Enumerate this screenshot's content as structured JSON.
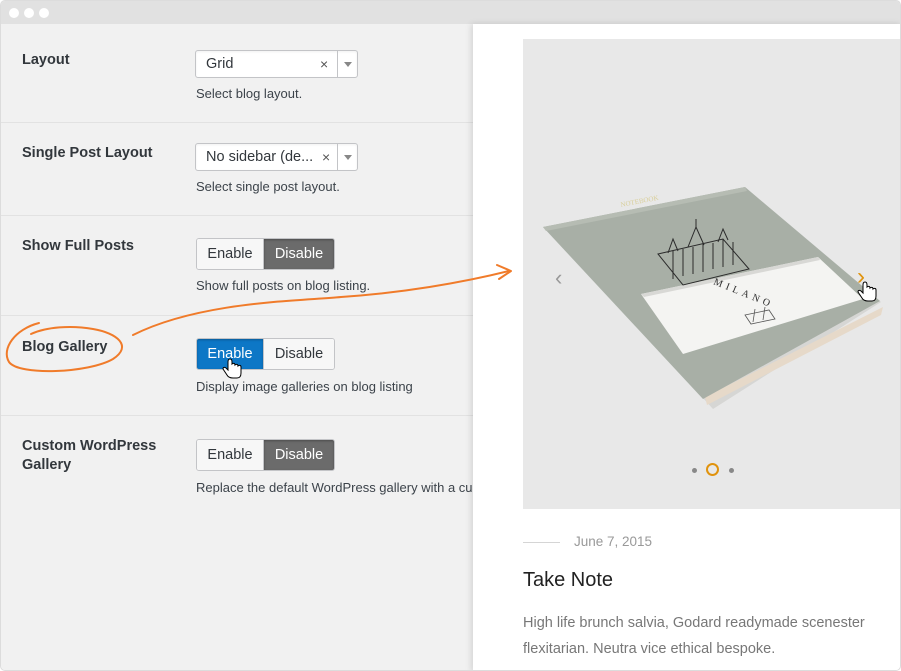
{
  "settings": {
    "layout": {
      "label": "Layout",
      "value": "Grid",
      "clear": "×",
      "description": "Select blog layout."
    },
    "single_post_layout": {
      "label": "Single Post Layout",
      "value": "No sidebar (de...",
      "clear": "×",
      "description": "Select single post layout."
    },
    "show_full_posts": {
      "label": "Show Full Posts",
      "enable": "Enable",
      "disable": "Disable",
      "selected": "Disable",
      "description": "Show full posts on blog listing."
    },
    "blog_gallery": {
      "label": "Blog Gallery",
      "enable": "Enable",
      "disable": "Disable",
      "selected": "Enable",
      "description": "Display image galleries on blog listing"
    },
    "custom_wp_gallery": {
      "label": "Custom WordPress Gallery",
      "enable": "Enable",
      "disable": "Disable",
      "selected": "Disable",
      "description": "Replace the default WordPress gallery with a cu"
    }
  },
  "preview": {
    "notebook_cover_text": "MILANO",
    "notebook_brand": "NOTEBOOK",
    "slider_prev_icon": "chevron-left-icon",
    "slider_next_icon": "chevron-right-icon",
    "slide_count": 3,
    "active_slide": 2,
    "post": {
      "date": "June 7, 2015",
      "title": "Take Note",
      "excerpt": "High life brunch salvia, Godard readymade scenester flexitarian. Neutra vice ethical bespoke."
    }
  },
  "colors": {
    "accent_blue": "#0d77c6",
    "active_dark": "#6b6b6b",
    "annotation_orange": "#f07b2a",
    "slider_accent": "#e0930e"
  }
}
